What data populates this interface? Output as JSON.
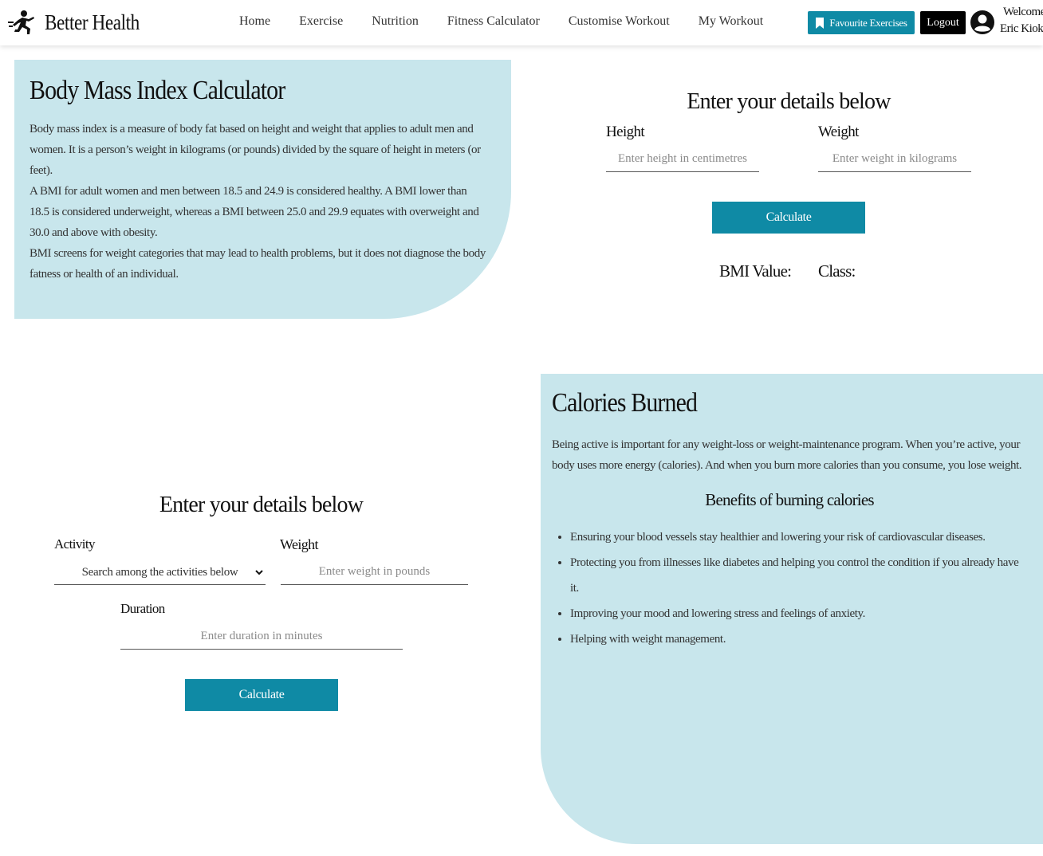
{
  "navbar": {
    "brand": "Better Health",
    "links": [
      "Home",
      "Exercise",
      "Nutrition",
      "Fitness Calculator",
      "Customise Workout",
      "My Workout"
    ],
    "favourite_label": "Favourite Exercises",
    "logout_label": "Logout",
    "welcome": "Welcome",
    "user_name": "Eric Kioko"
  },
  "bmi_info": {
    "title": "Body Mass Index Calculator",
    "paragraphs": [
      "Body mass index is a measure of body fat based on height and weight that applies to adult men and women. It is a person’s weight in kilograms (or pounds) divided by the square of height in meters (or feet).",
      "A BMI for adult women and men between 18.5 and 24.9 is considered healthy. A BMI lower than 18.5 is considered underweight, whereas a BMI between 25.0 and 29.9 equates with overweight and 30.0 and above with obesity.",
      "BMI screens for weight categories that may lead to health problems, but it does not diagnose the body fatness or health of an individual."
    ]
  },
  "bmi_form": {
    "title": "Enter your details below",
    "height_label": "Height",
    "height_placeholder": "Enter height in centimetres",
    "weight_label": "Weight",
    "weight_placeholder": "Enter weight in kilograms",
    "calculate_label": "Calculate",
    "bmi_value_label": "BMI Value:",
    "class_label": "Class:"
  },
  "calories_form": {
    "title": "Enter your details below",
    "activity_label": "Activity",
    "activity_selected": "Search among the activities below",
    "weight_label": "Weight",
    "weight_placeholder": "Enter weight in pounds",
    "duration_label": "Duration",
    "duration_placeholder": "Enter duration in minutes",
    "calculate_label": "Calculate"
  },
  "calories_info": {
    "title": "Calories Burned",
    "intro": "Being active is important for any weight-loss or weight-maintenance program. When you’re active, your body uses more energy (calories). And when you burn more calories than you consume, you lose weight.",
    "benefits_title": "Benefits of burning calories",
    "benefits": [
      "Ensuring your blood vessels stay healthier and lowering your risk of cardiovascular diseases.",
      "Protecting you from illnesses like diabetes and helping you control the condition if you already have it.",
      "Improving your mood and lowering stress and feelings of anxiety.",
      "Helping with weight management."
    ]
  },
  "colors": {
    "accent": "#0f8aa5",
    "card_background": "#c8e6ec"
  },
  "icons": [
    "runner-logo-icon",
    "bookmark-icon",
    "user-circle-icon",
    "chevron-down-icon"
  ]
}
